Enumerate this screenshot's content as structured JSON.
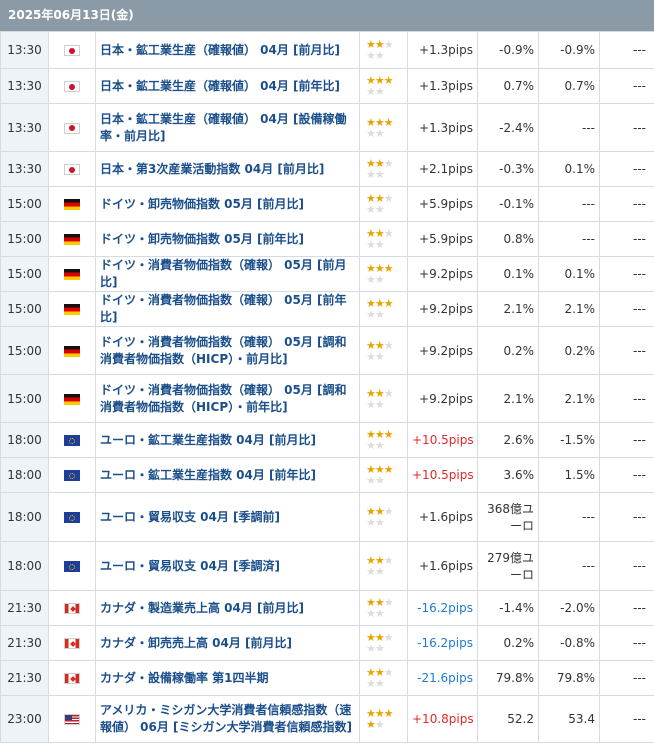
{
  "header": {
    "date": "2025年06月13日(金)"
  },
  "rows": [
    {
      "time": "13:30",
      "country": "jp",
      "name": "日本・鉱工業生産（確報値） 04月 [前月比]",
      "stars": 2,
      "pips": "+1.3pips",
      "pips_dir": "plain",
      "prev": "-0.9%",
      "forecast": "-0.9%",
      "actual": "---"
    },
    {
      "time": "13:30",
      "country": "jp",
      "name": "日本・鉱工業生産（確報値） 04月 [前年比]",
      "stars": 3,
      "pips": "+1.3pips",
      "pips_dir": "plain",
      "prev": "0.7%",
      "forecast": "0.7%",
      "actual": "---"
    },
    {
      "time": "13:30",
      "country": "jp",
      "name": "日本・鉱工業生産（確報値） 04月 [設備稼働率・前月比]",
      "stars": 3,
      "pips": "+1.3pips",
      "pips_dir": "plain",
      "prev": "-2.4%",
      "forecast": "---",
      "actual": "---"
    },
    {
      "time": "13:30",
      "country": "jp",
      "name": "日本・第3次産業活動指数 04月 [前月比]",
      "stars": 2,
      "pips": "+2.1pips",
      "pips_dir": "plain",
      "prev": "-0.3%",
      "forecast": "0.1%",
      "actual": "---"
    },
    {
      "time": "15:00",
      "country": "de",
      "name": "ドイツ・卸売物価指数 05月 [前月比]",
      "stars": 2,
      "pips": "+5.9pips",
      "pips_dir": "plain",
      "prev": "-0.1%",
      "forecast": "---",
      "actual": "---"
    },
    {
      "time": "15:00",
      "country": "de",
      "name": "ドイツ・卸売物価指数 05月 [前年比]",
      "stars": 2,
      "pips": "+5.9pips",
      "pips_dir": "plain",
      "prev": "0.8%",
      "forecast": "---",
      "actual": "---"
    },
    {
      "time": "15:00",
      "country": "de",
      "name": "ドイツ・消費者物価指数（確報） 05月 [前月比]",
      "stars": 3,
      "pips": "+9.2pips",
      "pips_dir": "plain",
      "prev": "0.1%",
      "forecast": "0.1%",
      "actual": "---"
    },
    {
      "time": "15:00",
      "country": "de",
      "name": "ドイツ・消費者物価指数（確報） 05月 [前年比]",
      "stars": 3,
      "pips": "+9.2pips",
      "pips_dir": "plain",
      "prev": "2.1%",
      "forecast": "2.1%",
      "actual": "---"
    },
    {
      "time": "15:00",
      "country": "de",
      "name": "ドイツ・消費者物価指数（確報） 05月 [調和消費者物価指数（HICP）・前月比]",
      "stars": 2,
      "pips": "+9.2pips",
      "pips_dir": "plain",
      "prev": "0.2%",
      "forecast": "0.2%",
      "actual": "---"
    },
    {
      "time": "15:00",
      "country": "de",
      "name": "ドイツ・消費者物価指数（確報） 05月 [調和消費者物価指数（HICP）・前年比]",
      "stars": 2,
      "pips": "+9.2pips",
      "pips_dir": "plain",
      "prev": "2.1%",
      "forecast": "2.1%",
      "actual": "---"
    },
    {
      "time": "18:00",
      "country": "eu",
      "name": "ユーロ・鉱工業生産指数 04月 [前月比]",
      "stars": 3,
      "pips": "+10.5pips",
      "pips_dir": "pos",
      "prev": "2.6%",
      "forecast": "-1.5%",
      "actual": "---"
    },
    {
      "time": "18:00",
      "country": "eu",
      "name": "ユーロ・鉱工業生産指数 04月 [前年比]",
      "stars": 3,
      "pips": "+10.5pips",
      "pips_dir": "pos",
      "prev": "3.6%",
      "forecast": "1.5%",
      "actual": "---"
    },
    {
      "time": "18:00",
      "country": "eu",
      "name": "ユーロ・貿易収支 04月 [季調前]",
      "stars": 2,
      "pips": "+1.6pips",
      "pips_dir": "plain",
      "prev": "368億ユーロ",
      "forecast": "---",
      "actual": "---"
    },
    {
      "time": "18:00",
      "country": "eu",
      "name": "ユーロ・貿易収支 04月 [季調済]",
      "stars": 2,
      "pips": "+1.6pips",
      "pips_dir": "plain",
      "prev": "279億ユーロ",
      "forecast": "---",
      "actual": "---"
    },
    {
      "time": "21:30",
      "country": "ca",
      "name": "カナダ・製造業売上高 04月 [前月比]",
      "stars": 2,
      "pips": "-16.2pips",
      "pips_dir": "neg",
      "prev": "-1.4%",
      "forecast": "-2.0%",
      "actual": "---"
    },
    {
      "time": "21:30",
      "country": "ca",
      "name": "カナダ・卸売売上高 04月 [前月比]",
      "stars": 2,
      "pips": "-16.2pips",
      "pips_dir": "neg",
      "prev": "0.2%",
      "forecast": "-0.8%",
      "actual": "---"
    },
    {
      "time": "21:30",
      "country": "ca",
      "name": "カナダ・設備稼働率 第1四半期",
      "stars": 2,
      "pips": "-21.6pips",
      "pips_dir": "neg",
      "prev": "79.8%",
      "forecast": "79.8%",
      "actual": "---"
    },
    {
      "time": "23:00",
      "country": "us",
      "name": "アメリカ・ミシガン大学消費者信頼感指数（速報値） 06月 [ミシガン大学消費者信頼感指数]",
      "stars": 4,
      "pips": "+10.8pips",
      "pips_dir": "pos",
      "prev": "52.2",
      "forecast": "53.4",
      "actual": "---"
    }
  ]
}
